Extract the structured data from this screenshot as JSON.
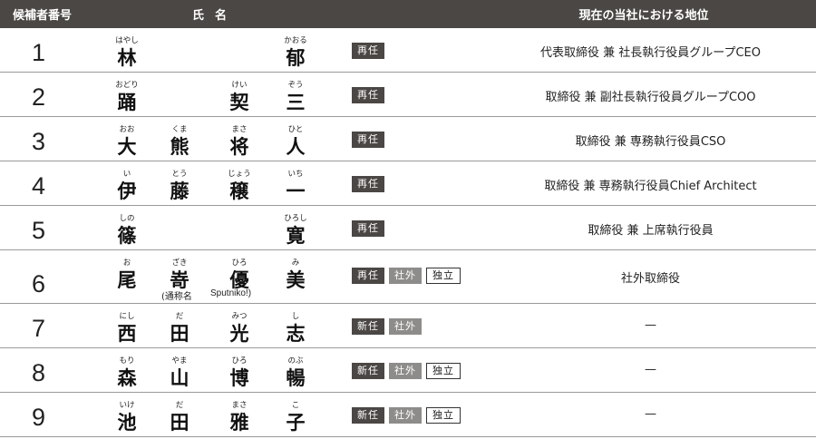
{
  "header": {
    "number": "候補者番号",
    "name": "氏名",
    "position": "現在の当社における地位"
  },
  "rows": [
    {
      "num": "1",
      "names": [
        {
          "ruby": "はやし",
          "kanji": "林"
        },
        {
          "ruby": "",
          "kanji": ""
        },
        {
          "ruby": "",
          "kanji": ""
        },
        {
          "ruby": "かおる",
          "kanji": "郁"
        }
      ],
      "tags": [
        "再任"
      ],
      "position": "代表取締役 兼 社長執行役員グループCEO"
    },
    {
      "num": "2",
      "names": [
        {
          "ruby": "おどり",
          "kanji": "踊"
        },
        {
          "ruby": "",
          "kanji": ""
        },
        {
          "ruby": "けい",
          "kanji": "契"
        },
        {
          "ruby": "ぞう",
          "kanji": "三"
        }
      ],
      "tags": [
        "再任"
      ],
      "position": "取締役 兼 副社長執行役員グループCOO"
    },
    {
      "num": "3",
      "names": [
        {
          "ruby": "おお",
          "kanji": "大"
        },
        {
          "ruby": "くま",
          "kanji": "熊"
        },
        {
          "ruby": "まさ",
          "kanji": "将"
        },
        {
          "ruby": "ひと",
          "kanji": "人"
        }
      ],
      "tags": [
        "再任"
      ],
      "position": "取締役 兼 専務執行役員CSO"
    },
    {
      "num": "4",
      "names": [
        {
          "ruby": "い",
          "kanji": "伊"
        },
        {
          "ruby": "とう",
          "kanji": "藤"
        },
        {
          "ruby": "じょう",
          "kanji": "穣"
        },
        {
          "ruby": "いち",
          "kanji": "一"
        }
      ],
      "tags": [
        "再任"
      ],
      "position": "取締役 兼 専務執行役員Chief Architect"
    },
    {
      "num": "5",
      "names": [
        {
          "ruby": "しの",
          "kanji": "篠"
        },
        {
          "ruby": "",
          "kanji": ""
        },
        {
          "ruby": "",
          "kanji": ""
        },
        {
          "ruby": "ひろし",
          "kanji": "寛"
        }
      ],
      "tags": [
        "再任"
      ],
      "position": "取締役 兼 上席執行役員"
    },
    {
      "num": "6",
      "names": [
        {
          "ruby": "お",
          "kanji": "尾"
        },
        {
          "ruby": "ざき",
          "kanji": "嵜"
        },
        {
          "ruby": "ひろ",
          "kanji": "優"
        },
        {
          "ruby": "み",
          "kanji": "美"
        }
      ],
      "alias_a": "(通称名",
      "alias_b": "Sputniko!)",
      "tags": [
        "再任",
        "社外",
        "独立"
      ],
      "position": "社外取締役"
    },
    {
      "num": "7",
      "names": [
        {
          "ruby": "にし",
          "kanji": "西"
        },
        {
          "ruby": "だ",
          "kanji": "田"
        },
        {
          "ruby": "みつ",
          "kanji": "光"
        },
        {
          "ruby": "し",
          "kanji": "志"
        }
      ],
      "tags": [
        "新任",
        "社外"
      ],
      "position": "—"
    },
    {
      "num": "8",
      "names": [
        {
          "ruby": "もり",
          "kanji": "森"
        },
        {
          "ruby": "やま",
          "kanji": "山"
        },
        {
          "ruby": "ひろ",
          "kanji": "博"
        },
        {
          "ruby": "のぶ",
          "kanji": "暢"
        }
      ],
      "tags": [
        "新任",
        "社外",
        "独立"
      ],
      "position": "—"
    },
    {
      "num": "9",
      "names": [
        {
          "ruby": "いけ",
          "kanji": "池"
        },
        {
          "ruby": "だ",
          "kanji": "田"
        },
        {
          "ruby": "まさ",
          "kanji": "雅"
        },
        {
          "ruby": "こ",
          "kanji": "子"
        }
      ],
      "tags": [
        "新任",
        "社外",
        "独立"
      ],
      "position": "—"
    }
  ],
  "tag_styles": {
    "再任": "dark",
    "新任": "dark",
    "社外": "gray",
    "独立": "outline"
  }
}
